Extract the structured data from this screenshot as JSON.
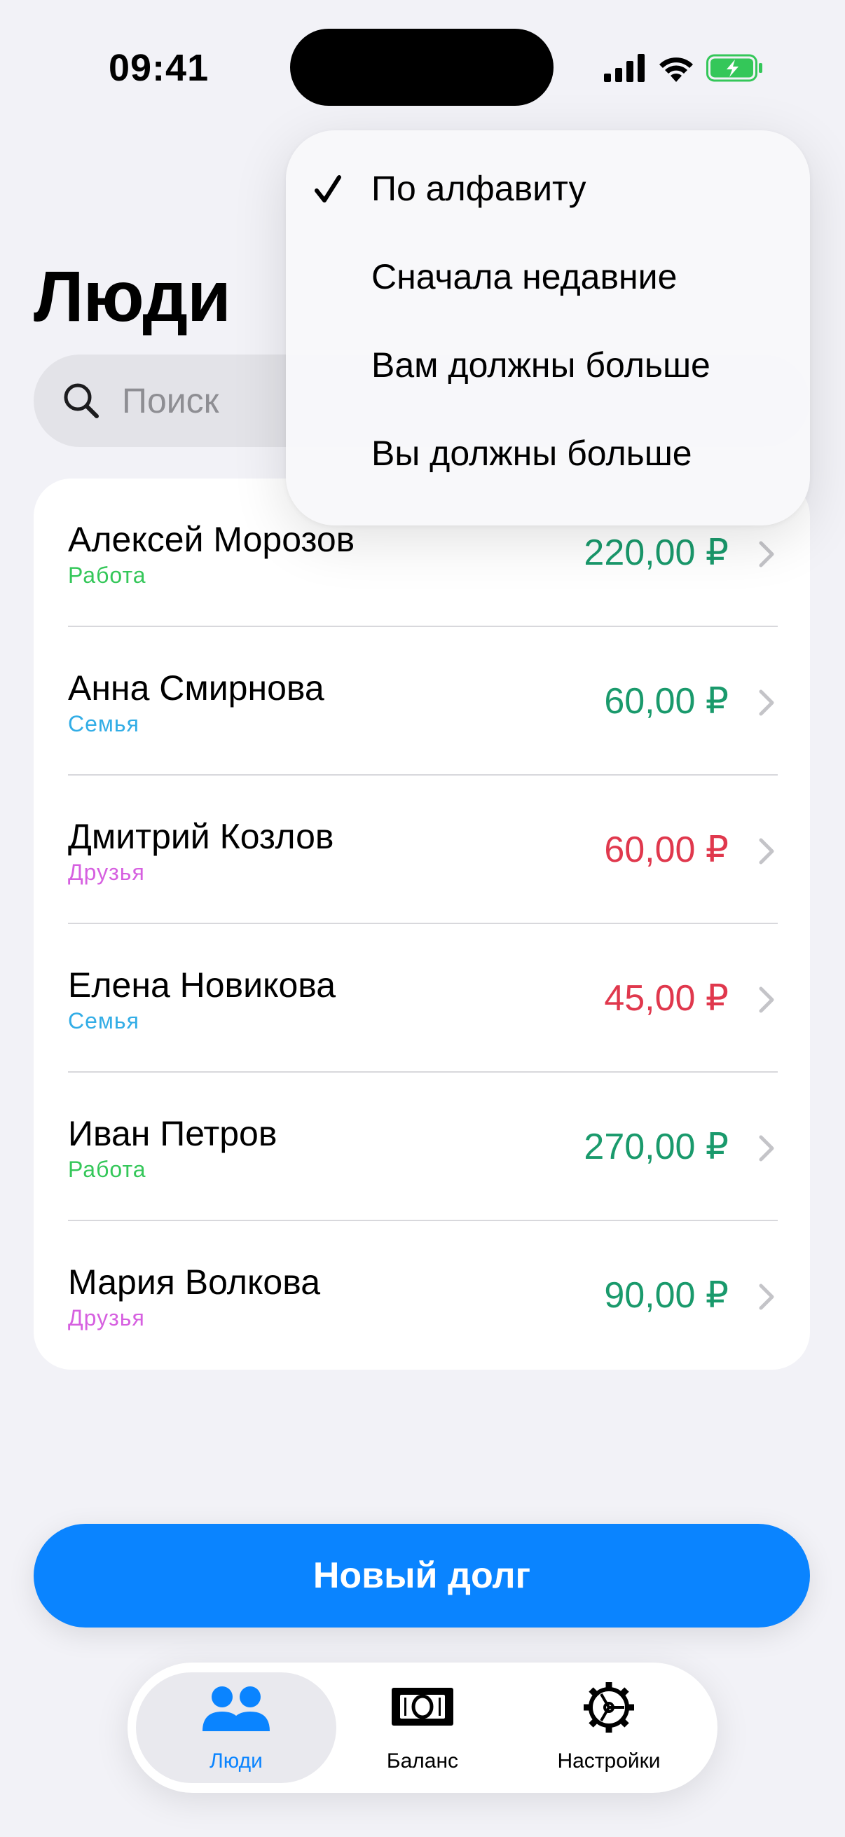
{
  "status_bar": {
    "time": "09:41"
  },
  "title": "Люди",
  "search": {
    "placeholder": "Поиск",
    "value": ""
  },
  "sort_menu": {
    "items": [
      {
        "label": "По алфавиту",
        "checked": true
      },
      {
        "label": "Сначала недавние",
        "checked": false
      },
      {
        "label": "Вам должны больше",
        "checked": false
      },
      {
        "label": "Вы должны больше",
        "checked": false
      }
    ]
  },
  "people": [
    {
      "name": "Алексей Морозов",
      "group": "Работа",
      "group_color": "#34c759",
      "amount": "220,00 ₽",
      "amount_color": "#1a9a6c"
    },
    {
      "name": "Анна Смирнова",
      "group": "Семья",
      "group_color": "#32ade6",
      "amount": "60,00 ₽",
      "amount_color": "#1a9a6c"
    },
    {
      "name": "Дмитрий Козлов",
      "group": "Друзья",
      "group_color": "#d660e0",
      "amount": "60,00 ₽",
      "amount_color": "#e0384d"
    },
    {
      "name": "Елена Новикова",
      "group": "Семья",
      "group_color": "#32ade6",
      "amount": "45,00 ₽",
      "amount_color": "#e0384d"
    },
    {
      "name": "Иван Петров",
      "group": "Работа",
      "group_color": "#34c759",
      "amount": "270,00 ₽",
      "amount_color": "#1a9a6c"
    },
    {
      "name": "Мария Волкова",
      "group": "Друзья",
      "group_color": "#d660e0",
      "amount": "90,00 ₽",
      "amount_color": "#1a9a6c"
    }
  ],
  "primary_button": {
    "label": "Новый долг",
    "color": "#0a84ff"
  },
  "tabbar": {
    "tabs": [
      {
        "label": "Люди",
        "icon": "people-icon",
        "active": true,
        "color": "#0a84ff"
      },
      {
        "label": "Баланс",
        "icon": "banknote-icon",
        "active": false,
        "color": "#000000"
      },
      {
        "label": "Настройки",
        "icon": "gear-icon",
        "active": false,
        "color": "#000000"
      }
    ]
  }
}
